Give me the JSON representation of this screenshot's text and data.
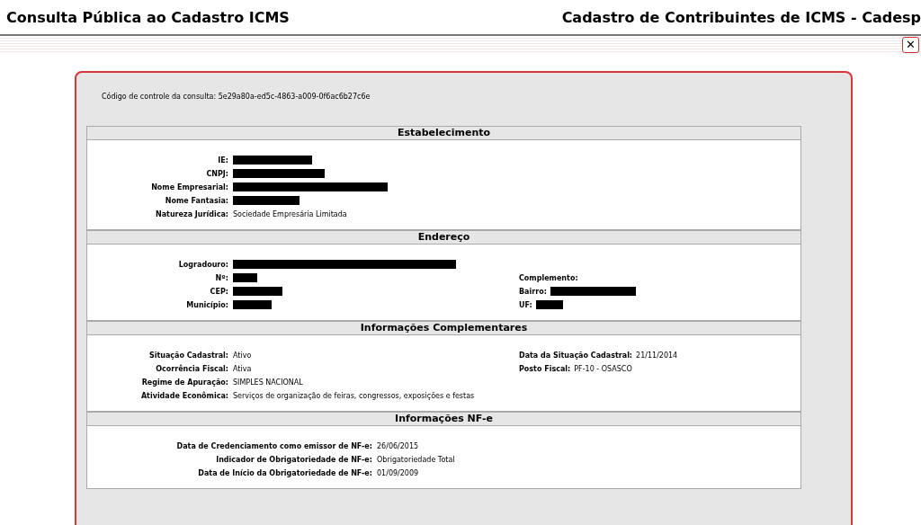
{
  "header": {
    "title": "Consulta Pública ao Cadastro ICMS",
    "subtitle": "Cadastro de Contribuintes de ICMS - Cadesp",
    "close": "✕"
  },
  "control_code": "Código de controle da consulta: 5e29a80a-ed5c-4863-a009-0f6ac6b27c6e",
  "sections": [
    {
      "title": "Estabelecimento",
      "rows": [
        {
          "left": {
            "label": "IE:",
            "redacted": true
          }
        },
        {
          "left": {
            "label": "CNPJ:",
            "redacted": true
          }
        },
        {
          "left": {
            "label": "Nome Empresarial:",
            "redacted": true
          }
        },
        {
          "left": {
            "label": "Nome Fantasia:",
            "redacted": true
          }
        },
        {
          "left": {
            "label": "Natureza Jurídica:",
            "value": "Sociedade Empresária Limitada"
          }
        }
      ]
    },
    {
      "title": "Endereço",
      "rows": [
        {
          "left": {
            "label": "Logradouro:",
            "redacted": true
          }
        },
        {
          "left": {
            "label": "Nº:",
            "redacted": true
          },
          "right": {
            "label": "Complemento:"
          }
        },
        {
          "left": {
            "label": "CEP:",
            "redacted": true
          },
          "right": {
            "label": "Bairro:",
            "redacted": true
          }
        },
        {
          "left": {
            "label": "Município:",
            "redacted": true
          },
          "right": {
            "label": "UF:",
            "redacted": true
          }
        }
      ]
    },
    {
      "title": "Informações Complementares",
      "rows": [
        {
          "left": {
            "label": "Situação Cadastral:",
            "value": "Ativo"
          },
          "right": {
            "label": "Data da Situação Cadastral:",
            "value": "21/11/2014"
          }
        },
        {
          "left": {
            "label": "Ocorrência Fiscal:",
            "value": "Ativa"
          },
          "right": {
            "label": "Posto Fiscal:",
            "value": "PF-10 - OSASCO"
          }
        },
        {
          "left": {
            "label": "Regime de Apuração:",
            "value": "SIMPLES NACIONAL"
          }
        },
        {
          "left": {
            "label": "Atividade Econômica:",
            "value": "Serviços de organização de feiras, congressos, exposições e festas"
          }
        }
      ]
    },
    {
      "title": "Informações NF-e",
      "rows": [
        {
          "left": {
            "label": "Data de Credenciamento como emissor de NF-e:",
            "value": "26/06/2015"
          }
        },
        {
          "left": {
            "label": "Indicador de Obrigatoriedade de NF-e:",
            "value": "Obrigatoriedade Total"
          }
        },
        {
          "left": {
            "label": "Data de Início da Obrigatoriedade de NF-e:",
            "value": "01/09/2009"
          }
        }
      ]
    }
  ]
}
